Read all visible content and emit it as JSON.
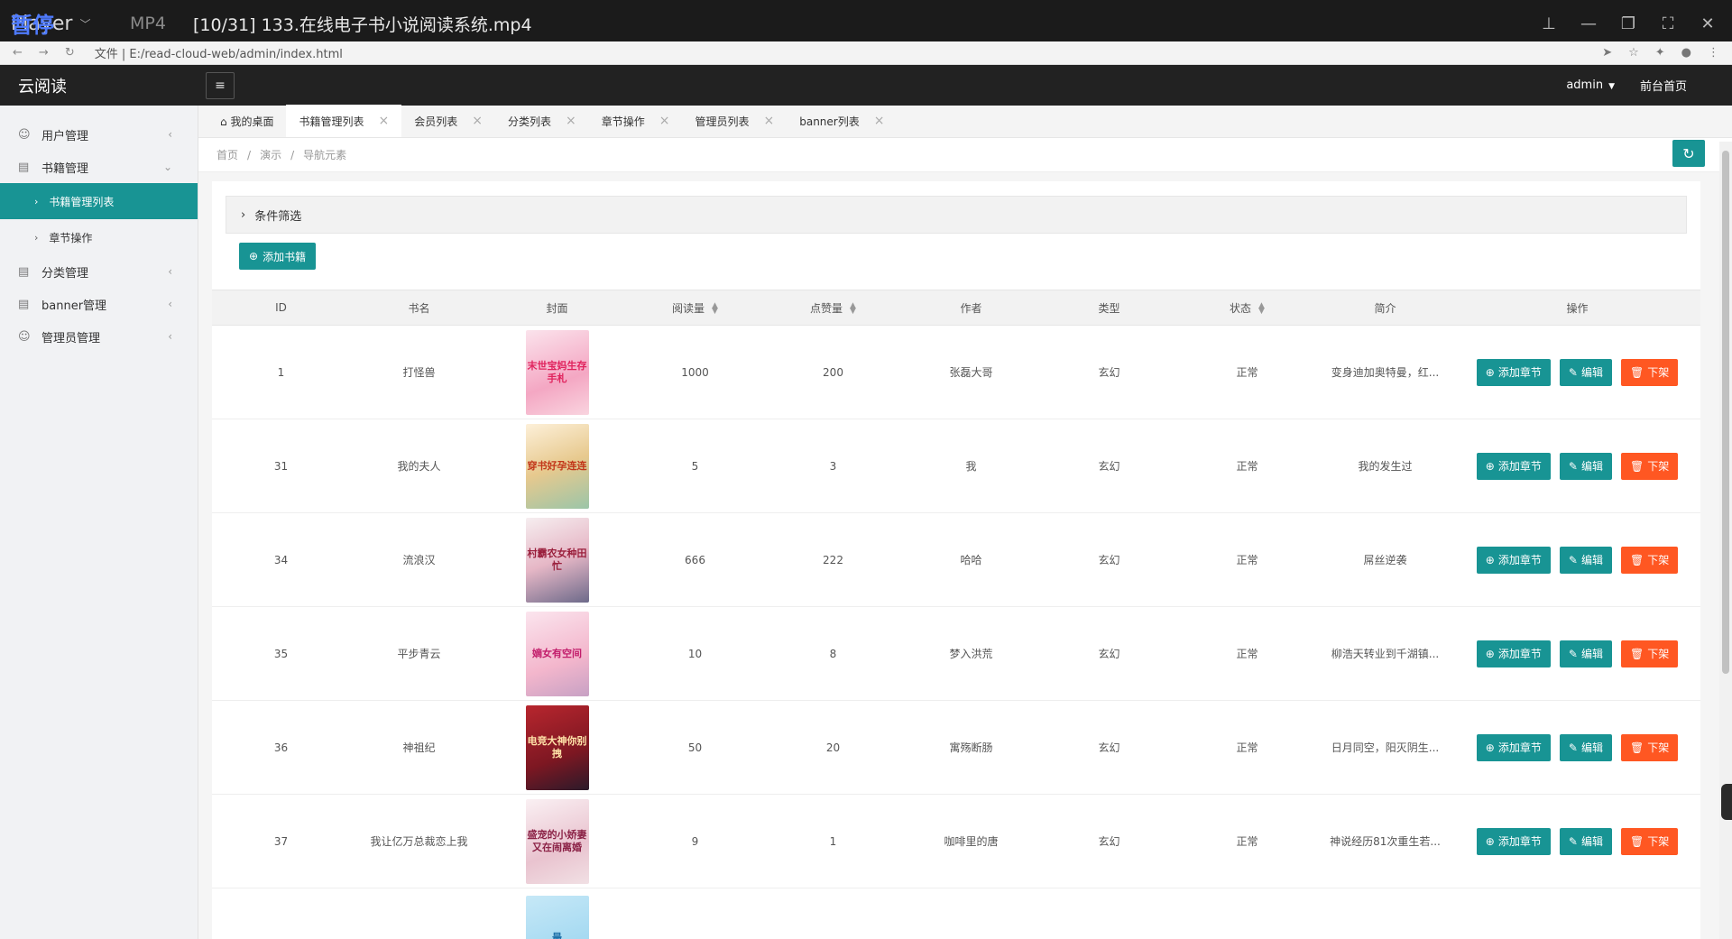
{
  "player": {
    "logo_text": "Player",
    "pause_label": "暂停",
    "format": "MP4",
    "title": "[10/31] 133.在线电子书小说阅读系统.mp4"
  },
  "browser": {
    "url": "文件 | E:/read-cloud-web/admin/index.html"
  },
  "app": {
    "logo": "云阅读",
    "user": "admin",
    "front_link": "前台首页"
  },
  "sidebar": {
    "items": [
      {
        "label": "用户管理",
        "icon": "user-icon"
      },
      {
        "label": "书籍管理",
        "icon": "book-icon"
      },
      {
        "label": "分类管理",
        "icon": "category-icon"
      },
      {
        "label": "banner管理",
        "icon": "banner-icon"
      },
      {
        "label": "管理员管理",
        "icon": "admin-icon"
      }
    ],
    "sub_items": [
      {
        "label": "书籍管理列表"
      },
      {
        "label": "章节操作"
      }
    ]
  },
  "tabs": [
    {
      "label": "我的桌面"
    },
    {
      "label": "书籍管理列表"
    },
    {
      "label": "会员列表"
    },
    {
      "label": "分类列表"
    },
    {
      "label": "章节操作"
    },
    {
      "label": "管理员列表"
    },
    {
      "label": "banner列表"
    }
  ],
  "breadcrumb": [
    "首页",
    "演示",
    "导航元素"
  ],
  "filter_label": "条件筛选",
  "add_book_label": "添加书籍",
  "table": {
    "headers": [
      "ID",
      "书名",
      "封面",
      "阅读量",
      "点赞量",
      "作者",
      "类型",
      "状态",
      "简介",
      "操作"
    ],
    "rows": [
      {
        "id": "1",
        "name": "打怪兽",
        "cover": "末世宝妈生存手札",
        "read": "1000",
        "like": "200",
        "author": "张磊大哥",
        "type": "玄幻",
        "status": "正常",
        "intro": "变身迪加奥特曼，红..."
      },
      {
        "id": "31",
        "name": "我的夫人",
        "cover": "穿书好孕连连",
        "read": "5",
        "like": "3",
        "author": "我",
        "type": "玄幻",
        "status": "正常",
        "intro": "我的发生过"
      },
      {
        "id": "34",
        "name": "流浪汉",
        "cover": "村霸农女种田忙",
        "read": "666",
        "like": "222",
        "author": "哈哈",
        "type": "玄幻",
        "status": "正常",
        "intro": "屌丝逆袭"
      },
      {
        "id": "35",
        "name": "平步青云",
        "cover": "嫡女有空间",
        "read": "10",
        "like": "8",
        "author": "梦入洪荒",
        "type": "玄幻",
        "status": "正常",
        "intro": "柳浩天转业到千湖镇..."
      },
      {
        "id": "36",
        "name": "神祖纪",
        "cover": "电竞大神你别拽",
        "read": "50",
        "like": "20",
        "author": "寓殇断肠",
        "type": "玄幻",
        "status": "正常",
        "intro": "日月同空，阳灭阴生..."
      },
      {
        "id": "37",
        "name": "我让亿万总裁恋上我",
        "cover": "盛宠的小娇妻又在闹离婚",
        "read": "9",
        "like": "1",
        "author": "咖啡里的唐",
        "type": "玄幻",
        "status": "正常",
        "intro": "神说经历81次重生若..."
      }
    ],
    "actions": {
      "add_chapter": "添加章节",
      "edit": "编辑",
      "offshelf": "下架"
    },
    "partial_cover": "最"
  },
  "colors": {
    "accent": "#189494",
    "danger": "#ff5722",
    "header": "#222222"
  }
}
